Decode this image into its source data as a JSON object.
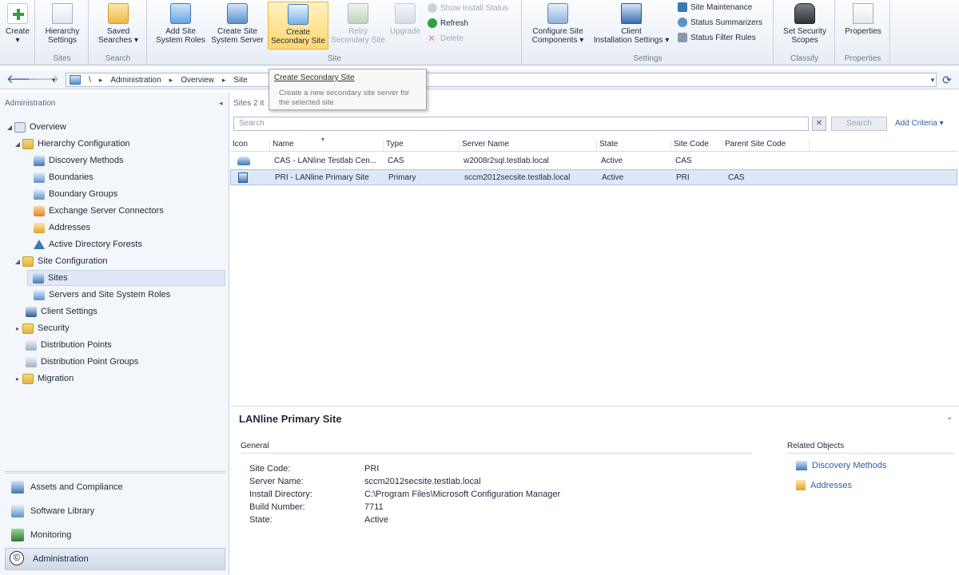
{
  "ribbon": {
    "create": {
      "label": "Create",
      "arrow": "▾",
      "group": ""
    },
    "hierarchy": {
      "label1": "Hierarchy",
      "label2": "Settings",
      "group": "Sites"
    },
    "search": {
      "label1": "Saved",
      "label2": "Searches ▾",
      "group": "Search"
    },
    "site": {
      "add_roles": {
        "label1": "Add Site",
        "label2": "System Roles"
      },
      "create_server": {
        "label1": "Create Site",
        "label2": "System Server"
      },
      "create_secondary": {
        "label1": "Create",
        "label2": "Secondary Site"
      },
      "retry": {
        "label1": "Retry",
        "label2": "Secondary Site"
      },
      "upgrade": {
        "label": "Upgrade"
      },
      "show_install": "Show Install Status",
      "refresh": "Refresh",
      "delete": "Delete",
      "group": "Site"
    },
    "settings": {
      "configure": {
        "label1": "Configure Site",
        "label2": "Components ▾"
      },
      "client": {
        "label1": "Client",
        "label2": "Installation Settings ▾"
      },
      "maintenance": "Site Maintenance",
      "summarizers": "Status Summarizers",
      "filter": "Status Filter Rules",
      "group": "Settings"
    },
    "classify": {
      "label1": "Set Security",
      "label2": "Scopes",
      "group": "Classify"
    },
    "properties": {
      "label": "Properties",
      "group": "Properties"
    }
  },
  "address": {
    "back": "🡐",
    "forward": "🡒",
    "dropdown": "▾",
    "root": "\\",
    "crumbs": [
      "Administration",
      "Overview",
      "Site"
    ],
    "sep": "▸"
  },
  "tooltip": {
    "title": "Create Secondary Site",
    "desc1": "Create a new secondary site server for",
    "desc2": "the selected site"
  },
  "nav": {
    "header": "Administration",
    "collapse": "◂",
    "tree": [
      {
        "label": "Overview",
        "twist": "◢"
      },
      {
        "label": "Hierarchy Configuration",
        "twist": "◢"
      },
      {
        "label": "Discovery Methods",
        "twist": ""
      },
      {
        "label": "Boundaries",
        "twist": ""
      },
      {
        "label": "Boundary Groups",
        "twist": ""
      },
      {
        "label": "Exchange Server Connectors",
        "twist": ""
      },
      {
        "label": "Addresses",
        "twist": ""
      },
      {
        "label": "Active Directory Forests",
        "twist": ""
      },
      {
        "label": "Site Configuration",
        "twist": "◢"
      },
      {
        "label": "Sites",
        "twist": ""
      },
      {
        "label": "Servers and Site System Roles",
        "twist": ""
      },
      {
        "label": "Client Settings",
        "twist": ""
      },
      {
        "label": "Security",
        "twist": "▸"
      },
      {
        "label": "Distribution Points",
        "twist": ""
      },
      {
        "label": "Distribution Point Groups",
        "twist": ""
      },
      {
        "label": "Migration",
        "twist": "▸"
      }
    ],
    "workspaces": [
      "Assets and Compliance",
      "Software Library",
      "Monitoring",
      "Administration"
    ],
    "copyright": "©"
  },
  "main": {
    "count": "Sites 2 it",
    "search_placeholder": "Search",
    "clear": "✕",
    "search_btn": "Search",
    "add_criteria": "Add Criteria ▾",
    "columns": [
      "Icon",
      "Name",
      "Type",
      "Server Name",
      "State",
      "Site Code",
      "Parent Site Code"
    ],
    "rows": [
      {
        "name": "CAS - LANline Testlab Cen...",
        "type": "CAS",
        "server": "w2008r2sql.testlab.local",
        "state": "Active",
        "code": "CAS",
        "parent": ""
      },
      {
        "name": "PRI - LANline Primary Site",
        "type": "Primary",
        "server": "sccm2012secsite.testlab.local",
        "state": "Active",
        "code": "PRI",
        "parent": "CAS"
      }
    ]
  },
  "details": {
    "title": "LANline Primary Site",
    "chevron": "⌄",
    "general": "General",
    "labels": [
      "Site Code:",
      "Server Name:",
      "Install Directory:",
      "Build Number:",
      "State:"
    ],
    "values": [
      "PRI",
      "sccm2012secsite.testlab.local",
      "C:\\Program Files\\Microsoft Configuration Manager",
      "7711",
      "Active"
    ],
    "related_title": "Related Objects",
    "related": [
      "Discovery Methods",
      "Addresses"
    ]
  },
  "colors": {
    "accent": "#2f5fa8",
    "selected": "#ffd76e"
  }
}
